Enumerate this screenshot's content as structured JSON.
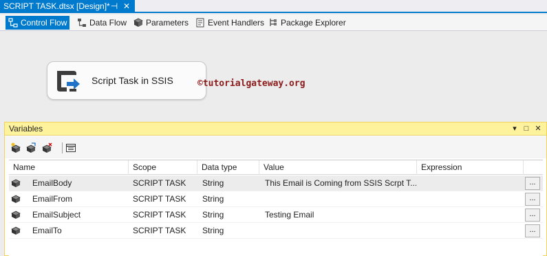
{
  "document_tab": {
    "title": "SCRIPT TASK.dtsx [Design]*",
    "pin": "⊣",
    "close": "✕"
  },
  "designer_tabs": [
    {
      "label": "Control Flow",
      "active": true
    },
    {
      "label": "Data Flow",
      "active": false
    },
    {
      "label": "Parameters",
      "active": false
    },
    {
      "label": "Event Handlers",
      "active": false
    },
    {
      "label": "Package Explorer",
      "active": false
    }
  ],
  "design_surface": {
    "task_label": "Script Task in SSIS",
    "watermark": "©tutorialgateway.org"
  },
  "variables_panel": {
    "title": "Variables",
    "title_buttons": {
      "dropdown": "▾",
      "maximize": "□",
      "close": "✕"
    },
    "columns": [
      "Name",
      "Scope",
      "Data type",
      "Value",
      "Expression"
    ],
    "rows": [
      {
        "name": "EmailBody",
        "scope": "SCRIPT TASK",
        "data_type": "String",
        "value": "This Email is Coming from SSIS Scrpt T...",
        "expression": "",
        "ellipsis": "...",
        "selected": true
      },
      {
        "name": "EmailFrom",
        "scope": "SCRIPT TASK",
        "data_type": "String",
        "value": "",
        "expression": "",
        "ellipsis": "...",
        "selected": false
      },
      {
        "name": "EmailSubject",
        "scope": "SCRIPT TASK",
        "data_type": "String",
        "value": "Testing Email",
        "expression": "",
        "ellipsis": "...",
        "selected": false
      },
      {
        "name": "EmailTo",
        "scope": "SCRIPT TASK",
        "data_type": "String",
        "value": "",
        "expression": "",
        "ellipsis": "...",
        "selected": false
      }
    ]
  },
  "colors": {
    "accent": "#007acc",
    "panel_title": "#fff29d",
    "watermark": "#8b1a1a"
  }
}
